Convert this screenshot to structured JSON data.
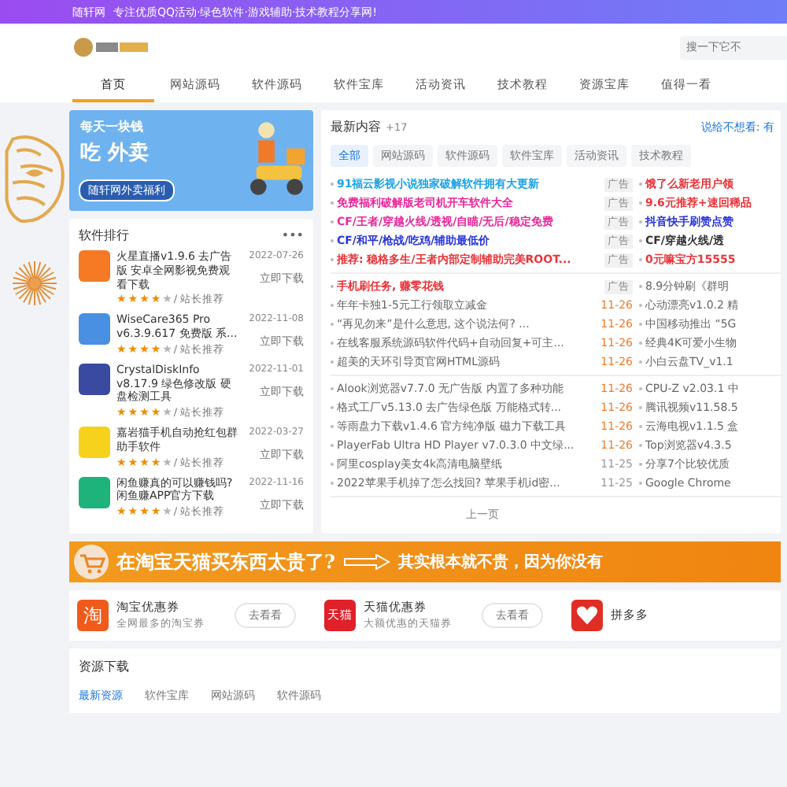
{
  "top_bar": {
    "site": "随轩网",
    "text": "专注优质QQ活动·绿色软件·游戏辅助·技术教程分享网!"
  },
  "header": {
    "search": {
      "placeholder": "搜一下它不"
    }
  },
  "nav": [
    {
      "label": "首页",
      "selected": true
    },
    {
      "label": "网站源码",
      "selected": false
    },
    {
      "label": "软件源码",
      "selected": false
    },
    {
      "label": "软件宝库",
      "selected": false
    },
    {
      "label": "活动资讯",
      "selected": false
    },
    {
      "label": "技术教程",
      "selected": false
    },
    {
      "label": "资源宝库",
      "selected": false
    },
    {
      "label": "值得一看",
      "selected": false
    }
  ],
  "banner": {
    "line_1": "每天一块钱",
    "line_2": "吃 外卖",
    "tag": "随轩网外卖福利"
  },
  "ranking": {
    "title": "软件排行",
    "more": "•••",
    "items": [
      {
        "title": "火星直播v1.9.6 去广告版 安卓全网影视免费观看下载",
        "stars": 4,
        "tag": "/ 站长推荐",
        "date": "2022-07-26",
        "button": "立即下载"
      },
      {
        "title": "WiseCare365 Pro v6.3.9.617 免费版 系...",
        "stars": 4,
        "tag": "/ 站长推荐",
        "date": "2022-11-08",
        "button": "立即下载"
      },
      {
        "title": "CrystalDiskInfo v8.17.9 绿色修改版 硬盘检测工具",
        "stars": 4,
        "tag": "/ 站长推荐",
        "date": "2022-11-01",
        "button": "立即下载"
      },
      {
        "title": "嘉岩猫手机自动抢红包群助手软件",
        "stars": 4,
        "tag": "/ 站长推荐",
        "date": "2022-03-27",
        "button": "立即下载"
      },
      {
        "title": "闲鱼赚真的可以赚钱吗? 闲鱼赚APP官方下载",
        "stars": 4,
        "tag": "/ 站长推荐",
        "date": "2022-11-16",
        "button": "立即下载"
      }
    ]
  },
  "latest": {
    "title": "最新内容",
    "count": "+17",
    "notice": "说给不想看: 有",
    "tabs": [
      {
        "label": "全部",
        "selected": true
      },
      {
        "label": "网站源码",
        "selected": false
      },
      {
        "label": "软件源码",
        "selected": false
      },
      {
        "label": "软件宝库",
        "selected": false
      },
      {
        "label": "活动资讯",
        "selected": false
      },
      {
        "label": "技术教程",
        "selected": false
      }
    ],
    "sections": [
      {
        "rows": [
          {
            "left": {
              "text": "91福云影视小说独家破解软件拥有大更新",
              "color": "#1aa3e8",
              "kind": "ad",
              "tag": "广告"
            },
            "right": {
              "text": "饿了么新老用户领",
              "color": "#e8343a"
            }
          },
          {
            "left": {
              "text": "免费福利破解版老司机开车软件大全",
              "color": "#e8289a",
              "kind": "ad",
              "tag": "广告"
            },
            "right": {
              "text": "9.6元推荐+速回稀品",
              "color": "#e8343a"
            }
          },
          {
            "left": {
              "text": "CF/王者/穿越火线/透视/自瞄/无后/稳定免费",
              "color": "#e8289a",
              "kind": "ad",
              "tag": "广告"
            },
            "right": {
              "text": "抖音快手刷赞点赞",
              "color": "#2b36d9"
            }
          },
          {
            "left": {
              "text": "CF/和平/枪战/吃鸡/辅助最低价",
              "color": "#2b36d9",
              "kind": "ad",
              "tag": "广告"
            },
            "right": {
              "text": "CF/穿越火线/透",
              "color": "#333333"
            }
          },
          {
            "left": {
              "text": "推荐: 稳格多生/王者内部定制辅助完美ROOT...",
              "color": "#e8343a",
              "kind": "ad",
              "tag": "广告"
            },
            "right": {
              "text": "0元嘛宝方15555",
              "color": "#e8343a"
            }
          }
        ]
      },
      {
        "rows": [
          {
            "left": {
              "text": "手机刷任务, 赚零花钱",
              "color": "#e8343a",
              "kind": "ad",
              "tag": "广告"
            },
            "right": {
              "text": "8.9分钟刷《群明",
              "color": "#666666"
            }
          },
          {
            "left": {
              "text": "年年卡独1-5元工行领取立减金",
              "color": "#666666",
              "kind": "post",
              "tag": "11-26"
            },
            "right": {
              "text": "心动漂亮v1.0.2 精",
              "color": "#666666"
            }
          },
          {
            "left": {
              "text": "“再见勿来”是什么意思, 这个说法何? ...",
              "color": "#666666",
              "kind": "post",
              "tag": "11-26"
            },
            "right": {
              "text": "中国移动推出 “5G",
              "color": "#666666"
            }
          },
          {
            "left": {
              "text": "在线客服系统源码软件代码+自动回复+可主...",
              "color": "#666666",
              "kind": "post",
              "tag": "11-26"
            },
            "right": {
              "text": "经典4K可爱小生物",
              "color": "#666666"
            }
          },
          {
            "left": {
              "text": "超美的天环引导页官网HTML源码",
              "color": "#666666",
              "kind": "post",
              "tag": "11-26"
            },
            "right": {
              "text": "小白云盘TV_v1.1",
              "color": "#666666"
            }
          }
        ]
      },
      {
        "rows": [
          {
            "left": {
              "text": "Alook浏览器v7.7.0 无广告版 内置了多种功能",
              "color": "#666666",
              "kind": "post",
              "tag": "11-26"
            },
            "right": {
              "text": "CPU-Z v2.03.1 中",
              "color": "#666666"
            }
          },
          {
            "left": {
              "text": "格式工厂v5.13.0 去广告绿色版 万能格式转...",
              "color": "#666666",
              "kind": "post",
              "tag": "11-26"
            },
            "right": {
              "text": "腾讯视频v11.58.5",
              "color": "#666666"
            }
          },
          {
            "left": {
              "text": "等雨盘力下载v1.4.6 官方纯净版 磁力下载工具",
              "color": "#666666",
              "kind": "post",
              "tag": "11-26"
            },
            "right": {
              "text": "云海电视v1.1.5 盒",
              "color": "#666666"
            }
          },
          {
            "left": {
              "text": "PlayerFab Ultra HD Player v7.0.3.0 中文绿...",
              "color": "#666666",
              "kind": "post",
              "tag": "11-26"
            },
            "right": {
              "text": "Top浏览器v4.3.5",
              "color": "#666666"
            }
          },
          {
            "left": {
              "text": "阿里cosplay美女4k高清电脑壁纸",
              "color": "#666666",
              "kind": "old",
              "tag": "11-25"
            },
            "right": {
              "text": "分享7个比较优质",
              "color": "#666666"
            }
          },
          {
            "left": {
              "text": "2022苹果手机掉了怎么找回? 苹果手机id密...",
              "color": "#666666",
              "kind": "old",
              "tag": "11-25"
            },
            "right": {
              "text": "Google Chrome",
              "color": "#666666"
            }
          }
        ]
      }
    ],
    "pager": "上一页"
  },
  "promo": {
    "left": "在淘宝天猫买东西太贵了?",
    "right": "其实根本就不贵，因为你没有"
  },
  "coupons": [
    {
      "kind": "taobao",
      "icon_text": "淘",
      "name": "淘宝优惠券",
      "desc": "全网最多的淘宝券",
      "button": "去看看"
    },
    {
      "kind": "tmall",
      "icon_text": "天猫",
      "name": "天猫优惠券",
      "desc": "大额优惠的天猫券",
      "button": "去看看"
    },
    {
      "kind": "pdd",
      "name": "拼多多"
    }
  ],
  "resources": {
    "title": "资源下载",
    "tabs": [
      {
        "label": "最新资源",
        "selected": true
      },
      {
        "label": "软件宝库",
        "selected": false
      },
      {
        "label": "网站源码",
        "selected": false
      },
      {
        "label": "软件源码",
        "selected": false
      }
    ]
  }
}
